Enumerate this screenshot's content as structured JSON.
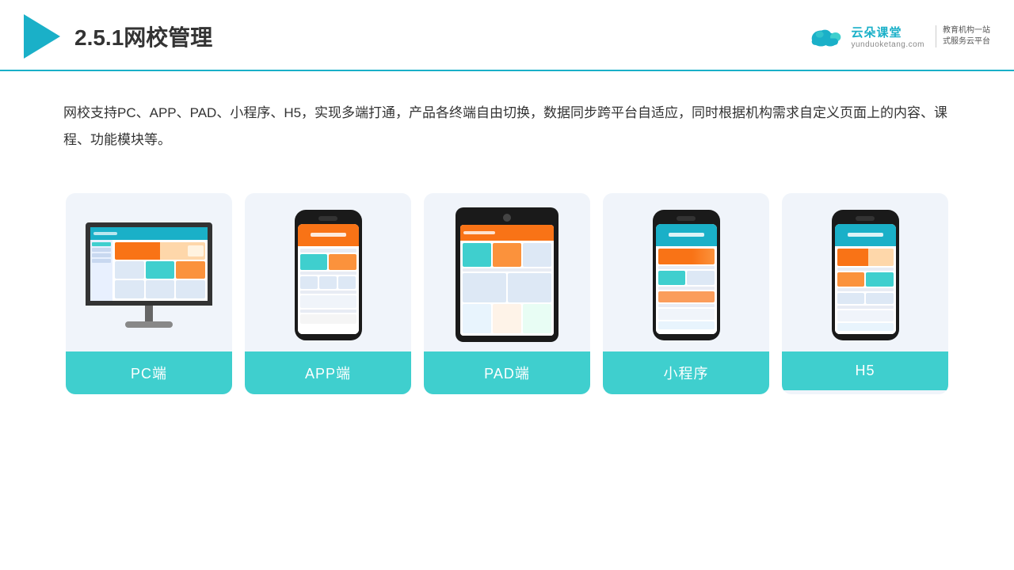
{
  "header": {
    "title": "2.5.1网校管理",
    "brand": {
      "name": "云朵课堂",
      "url": "yunduoketang.com",
      "tagline_line1": "教育机构一站",
      "tagline_line2": "式服务云平台"
    }
  },
  "description": {
    "text": "网校支持PC、APP、PAD、小程序、H5，实现多端打通，产品各终端自由切换，数据同步跨平台自适应，同时根据机构需求自定义页面上的内容、课程、功能模块等。"
  },
  "cards": [
    {
      "id": "pc",
      "label": "PC端",
      "type": "monitor"
    },
    {
      "id": "app",
      "label": "APP端",
      "type": "phone"
    },
    {
      "id": "pad",
      "label": "PAD端",
      "type": "tablet"
    },
    {
      "id": "miniapp",
      "label": "小程序",
      "type": "phone"
    },
    {
      "id": "h5",
      "label": "H5",
      "type": "phone"
    }
  ],
  "accent_color": "#3fcfce",
  "title_number": "2.5.1"
}
